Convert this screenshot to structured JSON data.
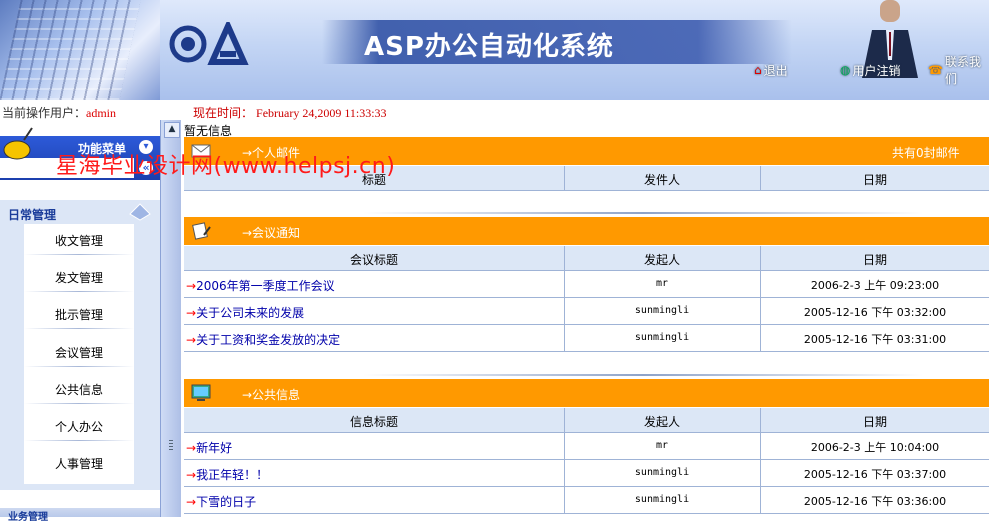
{
  "header": {
    "app_title": "ASP办公自动化系统",
    "links": [
      {
        "label": "退出",
        "icon": "home-icon"
      },
      {
        "label": "用户注销",
        "icon": "globe-icon"
      },
      {
        "label": "联系我们",
        "icon": "phone-icon"
      }
    ]
  },
  "info": {
    "current_user_label": "当前操作用户：",
    "current_user": "admin",
    "now_label": "现在时间：",
    "now_value": "February 24,2009 11:33:33"
  },
  "sidebar": {
    "menu_title": "功能菜单",
    "section_title": "日常管理",
    "items": [
      {
        "label": "收文管理"
      },
      {
        "label": "发文管理"
      },
      {
        "label": "批示管理"
      },
      {
        "label": "会议管理"
      },
      {
        "label": "公共信息"
      },
      {
        "label": "个人办公"
      },
      {
        "label": "人事管理"
      }
    ],
    "next_section_title": "业务管理"
  },
  "content": {
    "no_info": "暂无信息",
    "watermark": "星海毕业设计网(www.helpsj.cn)",
    "mail": {
      "title": "→个人邮件",
      "count_text": "共有0封邮件",
      "columns": [
        "标题",
        "发件人",
        "日期"
      ]
    },
    "meeting": {
      "title": "→会议通知",
      "columns": [
        "会议标题",
        "发起人",
        "日期"
      ],
      "rows": [
        {
          "title": "2006年第一季度工作会议",
          "sender": "mr",
          "date": "2006-2-3 上午 09:23:00"
        },
        {
          "title": "关于公司未来的发展",
          "sender": "sunmingli",
          "date": "2005-12-16 下午 03:32:00"
        },
        {
          "title": "关于工资和奖金发放的决定",
          "sender": "sunmingli",
          "date": "2005-12-16 下午 03:31:00"
        }
      ]
    },
    "public": {
      "title": "→公共信息",
      "columns": [
        "信息标题",
        "发起人",
        "日期"
      ],
      "rows": [
        {
          "title": "新年好",
          "sender": "mr",
          "date": "2006-2-3 上午 10:04:00"
        },
        {
          "title": "我正年轻！！",
          "sender": "sunmingli",
          "date": "2005-12-16 下午 03:37:00"
        },
        {
          "title": "下雪的日子",
          "sender": "sunmingli",
          "date": "2005-12-16 下午 03:36:00"
        }
      ]
    }
  },
  "colors": {
    "panel_orange": "#ff9900",
    "header_blue": "#2d5ad8",
    "row_link": "#0000aa",
    "watermark_red": "#ff1a1a"
  }
}
